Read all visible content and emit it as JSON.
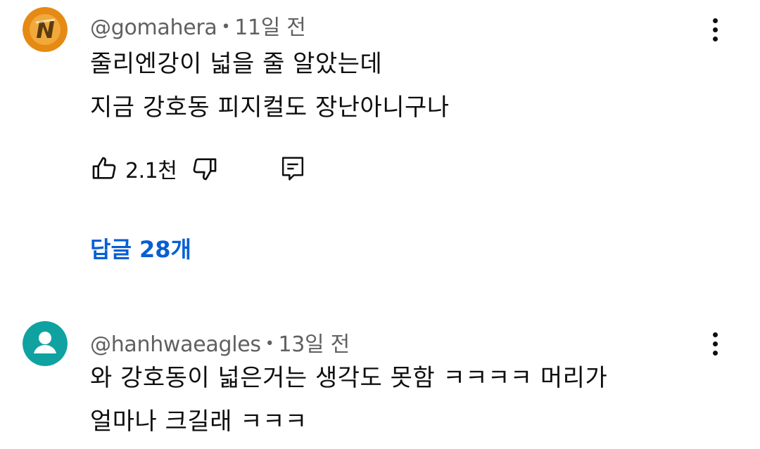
{
  "comments": [
    {
      "handle": "@gomahera",
      "separator": "•",
      "time": "11일 전",
      "lines": [
        "줄리엔강이 넓을 줄 알았는데",
        "지금 강호동 피지컬도 장난아니구나"
      ],
      "likes": "2.1천",
      "replies_label": "답글 28개",
      "avatar_icon": "custom-n-logo-icon",
      "avatar_color": "#e58a14"
    },
    {
      "handle": "@hanhwaeagles",
      "separator": "•",
      "time": "13일 전",
      "lines": [
        "와 강호동이 넓은거는 생각도 못함 ㅋㅋㅋㅋ 머리가",
        "얼마나 크길래 ㅋㅋㅋ"
      ],
      "avatar_icon": "default-person-icon",
      "avatar_color": "#0fa2a1"
    }
  ],
  "colors": {
    "text": "#0f0f0f",
    "meta": "#606060",
    "link": "#065fd4"
  }
}
